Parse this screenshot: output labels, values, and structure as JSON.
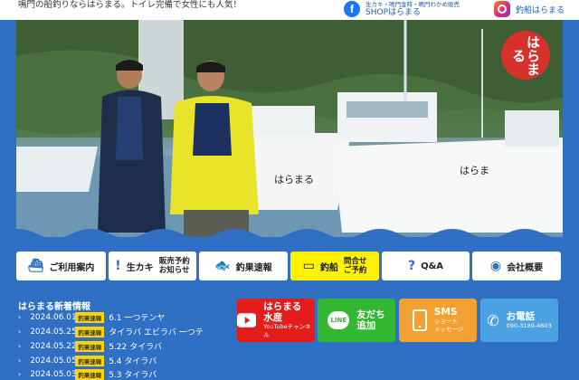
{
  "header": {
    "tagline": "鳴門の船釣りならはらまる。トイレ完備で女性にも人気！",
    "shop_sub": "生カキ・鳴門金時・鳴門わかめ販売",
    "shop_label": "SHOPはらまる",
    "instagram_label": "釣船はらまる"
  },
  "hero": {
    "logo_text": "はらまる",
    "boat_name": "はらまる"
  },
  "nav": [
    {
      "label": "ご利用案内",
      "icon": "boat-icon"
    },
    {
      "label_top": "生カキ",
      "label_a": "販売予約",
      "label_b": "お知らせ",
      "icon": "info-icon"
    },
    {
      "label": "釣果速報",
      "icon": "fish-icon"
    },
    {
      "label_a": "釣船",
      "label_b": "問合せ",
      "label_c": "ご予約",
      "icon": "monitor-icon"
    },
    {
      "label": "Q&A",
      "icon": "question-icon"
    },
    {
      "label": "会社概要",
      "icon": "globe-icon"
    }
  ],
  "news": {
    "title": "はらまる新着情報",
    "items": [
      {
        "date": "2024.06.01",
        "badge": "釣果速報",
        "text": "6.1 一つテンヤ"
      },
      {
        "date": "2024.05.25",
        "badge": "釣果速報",
        "text": "タイラバ エビラバ 一つテ"
      },
      {
        "date": "2024.05.22",
        "badge": "釣果速報",
        "text": "5.22 タイラバ"
      },
      {
        "date": "2024.05.05",
        "badge": "釣果速報",
        "text": "5.4 タイラバ"
      },
      {
        "date": "2024.05.03",
        "badge": "釣果速報",
        "text": "5.3 タイラバ"
      }
    ]
  },
  "buttons": {
    "youtube": {
      "line1": "はらまる",
      "line2": "水産",
      "sub": "YouTubeチャンネル"
    },
    "line": {
      "line1": "友だち",
      "line2": "追加",
      "icon_text": "LINE"
    },
    "sms": {
      "line1": "SMS",
      "sub1": "ショート",
      "sub2": "メッセージ"
    },
    "tel": {
      "line1": "お電話",
      "sub": "090-3189-4603"
    }
  },
  "colors": {
    "background": "#2f6fc4",
    "highlight": "#fff200",
    "youtube": "#e51c1c",
    "line": "#33b732",
    "sms": "#f3a033",
    "tel": "#4aa2e3",
    "logo": "#d8312b"
  }
}
